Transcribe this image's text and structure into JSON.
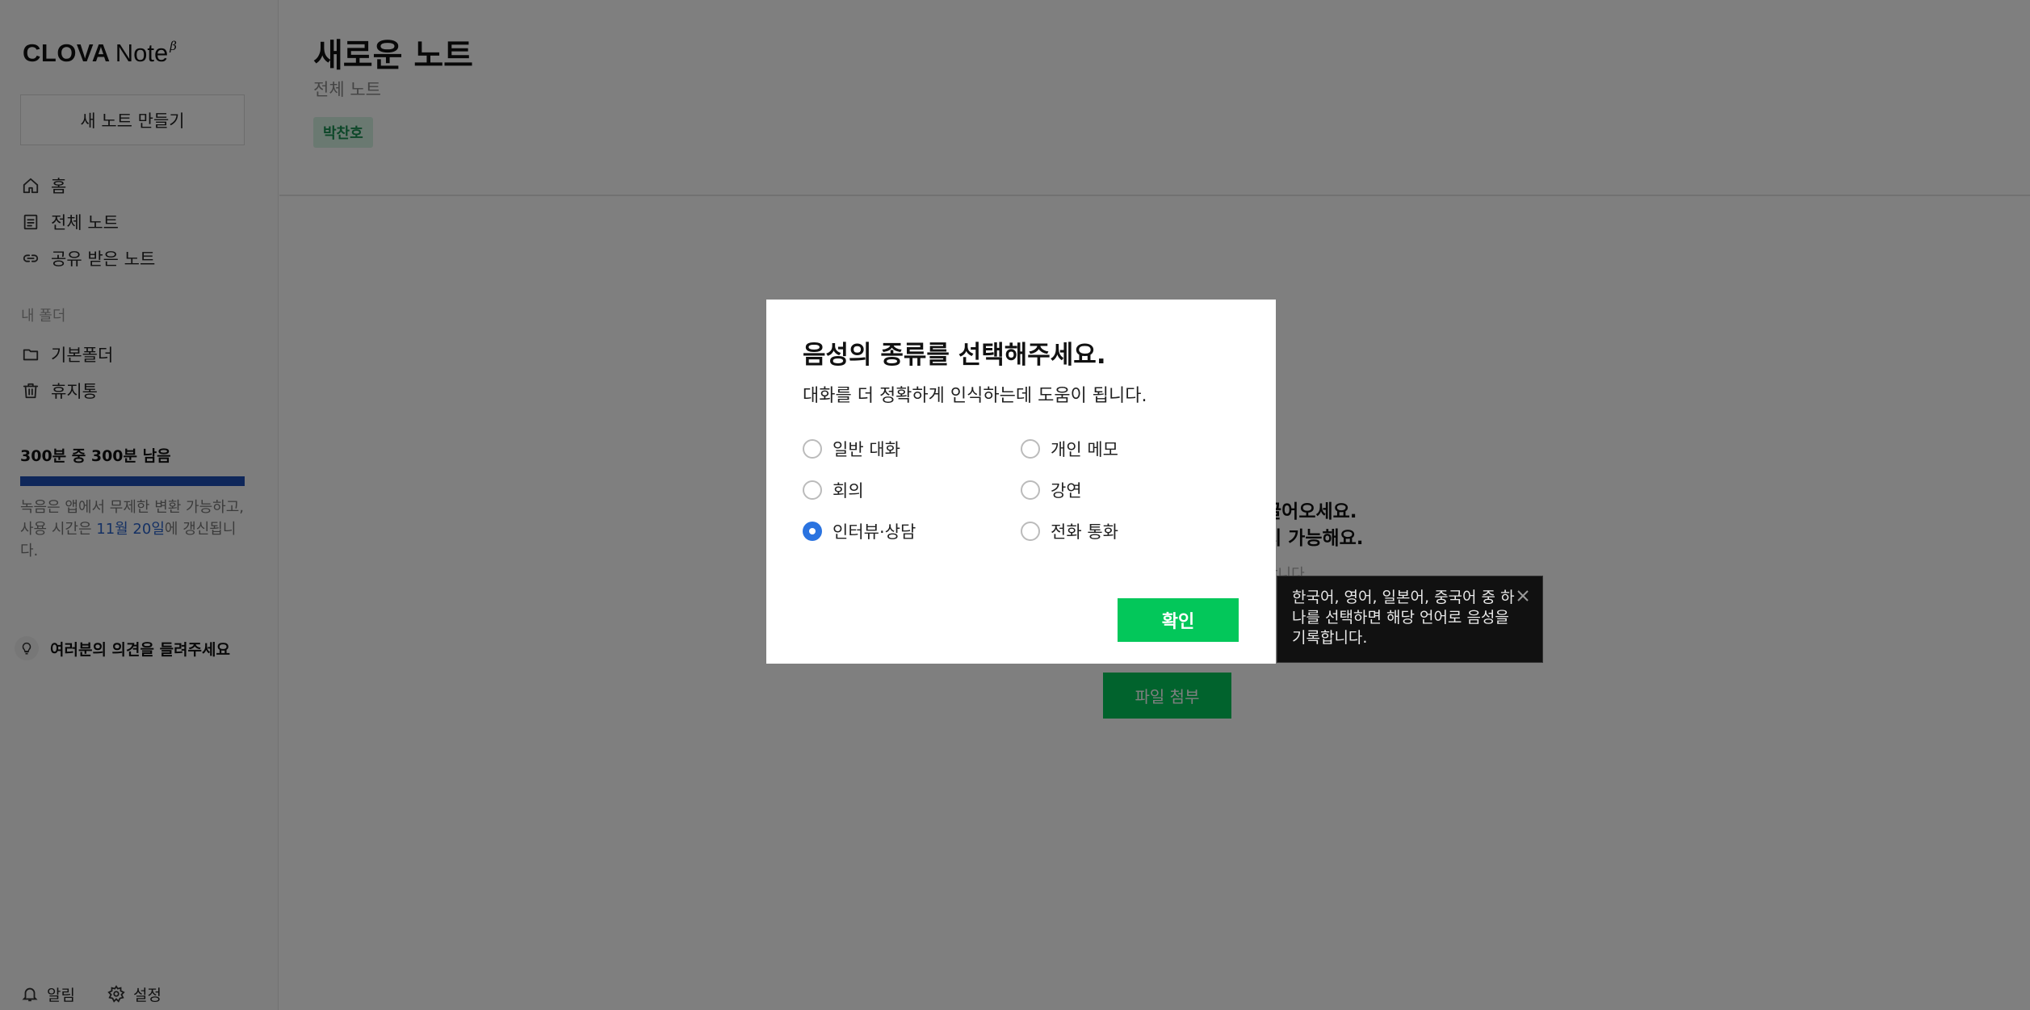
{
  "app": {
    "logo_main": "CLOVA",
    "logo_sub": "Note",
    "logo_beta": "β"
  },
  "sidebar": {
    "new_note_label": "새 노트 만들기",
    "nav": [
      {
        "label": "홈",
        "icon": "home-icon"
      },
      {
        "label": "전체 노트",
        "icon": "document-icon"
      },
      {
        "label": "공유 받은 노트",
        "icon": "link-icon"
      }
    ],
    "folder_heading": "내 폴더",
    "folders": [
      {
        "label": "기본폴더",
        "icon": "folder-icon"
      },
      {
        "label": "휴지통",
        "icon": "trash-icon"
      }
    ],
    "usage": {
      "title": "300분 중 300분 남음",
      "remaining_fraction": 1.0,
      "desc_before": "녹음은 앱에서 무제한 변환 가능하고, 사용 시간은 ",
      "desc_date": "11월 20일",
      "desc_after": "에 갱신됩니다."
    },
    "feedback_label": "여러분의 의견을 들려주세요",
    "alerts_label": "알림",
    "settings_label": "설정"
  },
  "main": {
    "title": "새로운 노트",
    "breadcrumb": "전체 노트",
    "tag": "박찬호",
    "upload_line1": "끌어오세요.",
    "upload_line2": "지 가능해요.",
    "upload_sub": "합니다",
    "file_attach_label": "파일 첨부"
  },
  "modal": {
    "title": "음성의 종류를 선택해주세요.",
    "description": "대화를 더 정확하게 인식하는데 도움이 됩니다.",
    "options": [
      {
        "label": "일반 대화",
        "checked": false
      },
      {
        "label": "개인 메모",
        "checked": false
      },
      {
        "label": "회의",
        "checked": false
      },
      {
        "label": "강연",
        "checked": false
      },
      {
        "label": "인터뷰·상담",
        "checked": true
      },
      {
        "label": "전화 통화",
        "checked": false
      }
    ],
    "confirm_label": "확인"
  },
  "tooltip": {
    "text": "한국어, 영어, 일본어, 중국어 중 하나를 선택하면 해당 언어로 음성을 기록합니다."
  },
  "colors": {
    "brand_green": "#03c75a",
    "accent_blue": "#2a73e0",
    "usage_bar": "#1f4fb4"
  }
}
